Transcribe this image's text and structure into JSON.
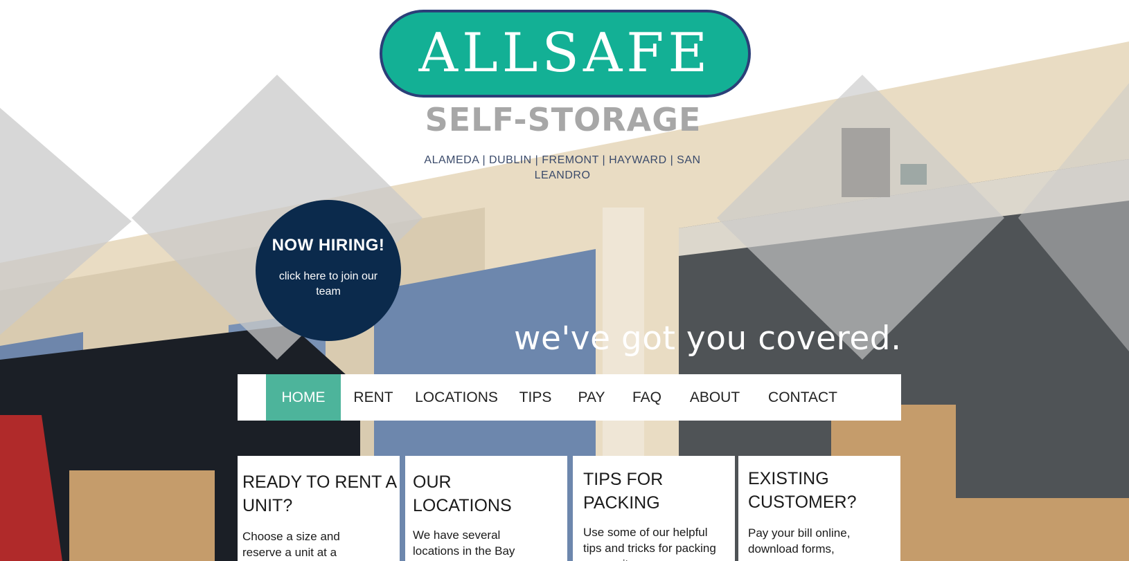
{
  "brand": {
    "logo_text": "ALLSAFE",
    "subtitle": "SELF-STORAGE",
    "cities": "ALAMEDA | DUBLIN | FREMONT | HAYWARD | SAN LEANDRO",
    "colors": {
      "teal": "#13b095",
      "navy": "#0b2a4c",
      "outline": "#2b3f78",
      "active": "#4db49b"
    }
  },
  "hiring": {
    "title": "NOW HIRING!",
    "subtitle": "click here to join our team"
  },
  "hero": {
    "tagline": "we've got you covered."
  },
  "nav": {
    "items": [
      {
        "label": "HOME",
        "active": true
      },
      {
        "label": "RENT"
      },
      {
        "label": "LOCATIONS"
      },
      {
        "label": "TIPS"
      },
      {
        "label": "PAY"
      },
      {
        "label": "FAQ"
      },
      {
        "label": "ABOUT"
      },
      {
        "label": "CONTACT"
      }
    ]
  },
  "cards": [
    {
      "title": "READY TO RENT A UNIT?",
      "text": "Choose a size and reserve a unit at a"
    },
    {
      "title": "OUR LOCATIONS",
      "text": "We have several locations in the Bay"
    },
    {
      "title": "TIPS FOR PACKING",
      "text": "Use some of our helpful tips and tricks for packing your unit"
    },
    {
      "title": "EXISTING CUSTOMER?",
      "text": "Pay your bill online, download forms,"
    }
  ]
}
